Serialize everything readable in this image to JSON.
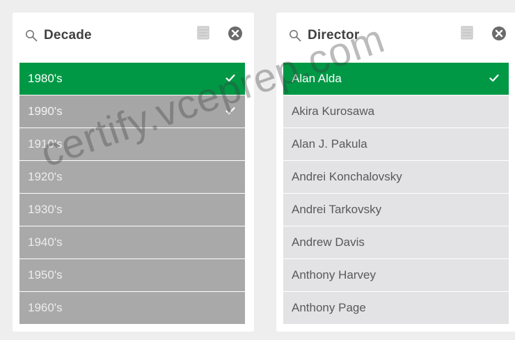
{
  "decade_panel": {
    "title": "Decade",
    "items": [
      {
        "label": "1980's",
        "state": "selected",
        "checked": true
      },
      {
        "label": "1990's",
        "state": "alternative",
        "checked": true
      },
      {
        "label": "1910's",
        "state": "excluded",
        "checked": false
      },
      {
        "label": "1920's",
        "state": "excluded",
        "checked": false
      },
      {
        "label": "1930's",
        "state": "excluded",
        "checked": false
      },
      {
        "label": "1940's",
        "state": "excluded",
        "checked": false
      },
      {
        "label": "1950's",
        "state": "excluded",
        "checked": false
      },
      {
        "label": "1960's",
        "state": "excluded",
        "checked": false
      }
    ]
  },
  "director_panel": {
    "title": "Director",
    "items": [
      {
        "label": "Alan Alda",
        "state": "selected",
        "checked": true
      },
      {
        "label": "Akira Kurosawa",
        "state": "possible",
        "checked": false
      },
      {
        "label": "Alan J. Pakula",
        "state": "possible",
        "checked": false
      },
      {
        "label": "Andrei Konchalovsky",
        "state": "possible",
        "checked": false
      },
      {
        "label": "Andrei Tarkovsky",
        "state": "possible",
        "checked": false
      },
      {
        "label": "Andrew Davis",
        "state": "possible",
        "checked": false
      },
      {
        "label": "Anthony Harvey",
        "state": "possible",
        "checked": false
      },
      {
        "label": "Anthony Page",
        "state": "possible",
        "checked": false
      }
    ]
  },
  "watermark": "certify.vceprep.com",
  "colors": {
    "selected_green": "#009845",
    "excluded_gray": "#a9a9a9",
    "possible_light": "#e3e3e5"
  }
}
